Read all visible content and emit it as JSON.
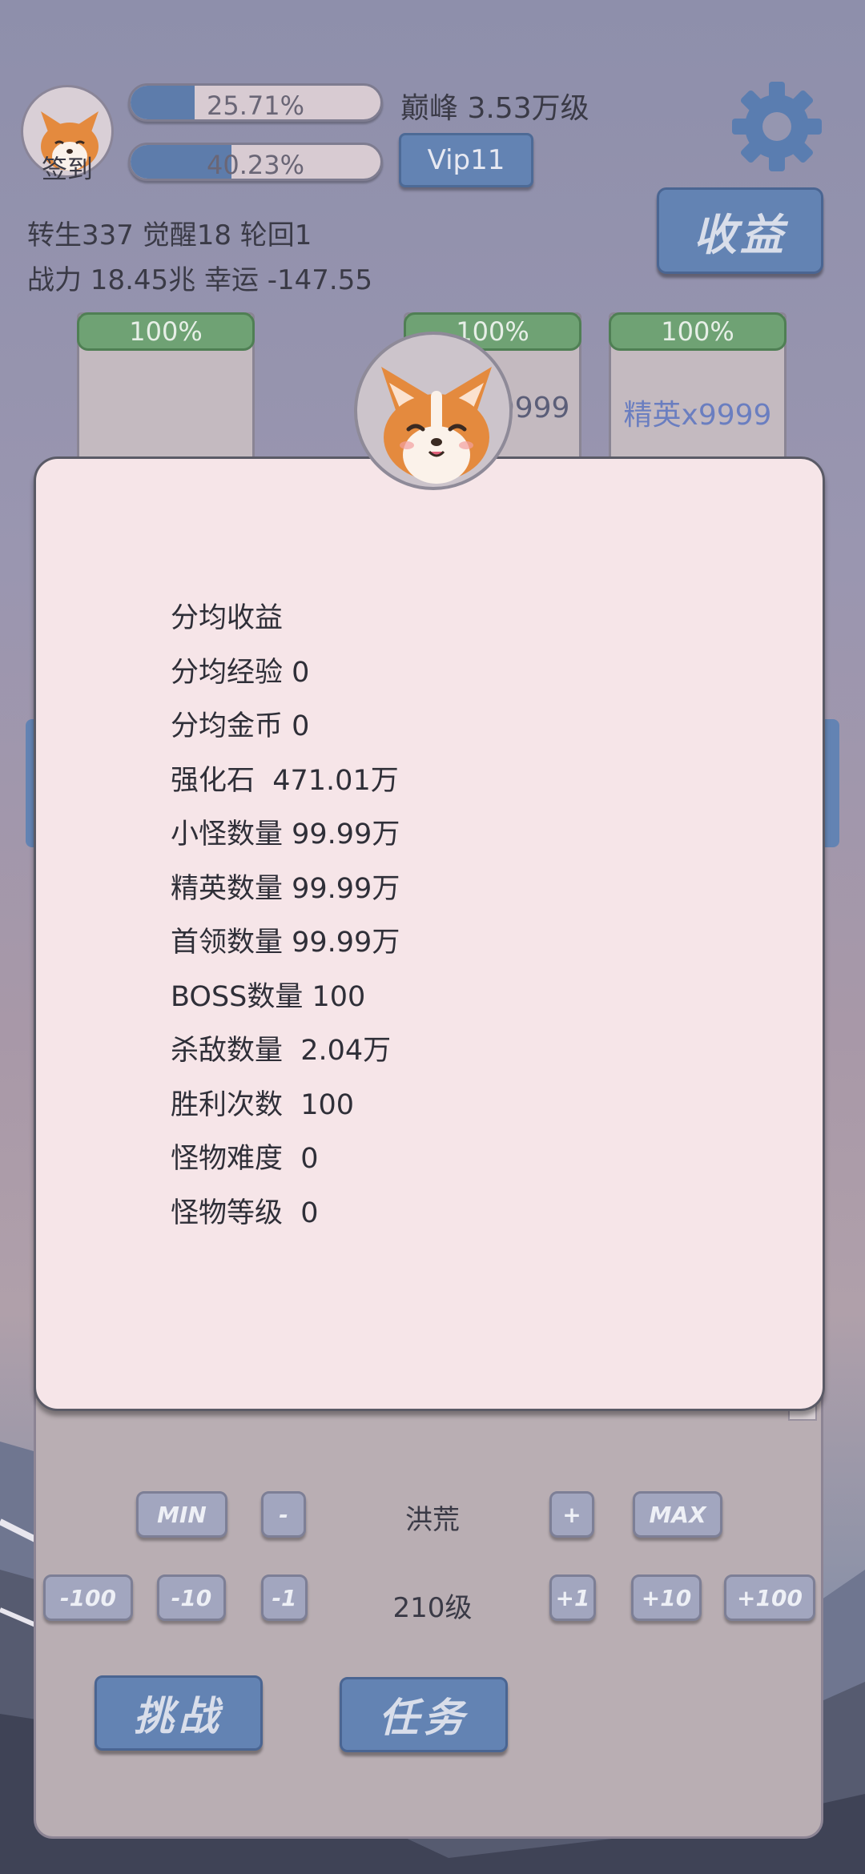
{
  "header": {
    "avatar_label": "签到",
    "bar1_text": "25.71%",
    "bar1_progress": 0.2571,
    "bar2_text": "40.23%",
    "bar2_progress": 0.4023,
    "peak_text": "巅峰 3.53万级",
    "vip_label": "Vip11",
    "income_label": "收益"
  },
  "stats": {
    "line1": "转生337 觉醒18 轮回1",
    "line2": "战力 18.45兆  幸运 -147.55"
  },
  "cards": [
    {
      "pct": "100%",
      "label": ""
    },
    {
      "pct": "100%",
      "label": "x9999"
    },
    {
      "pct": "100%",
      "label": "精英x9999"
    }
  ],
  "modal": {
    "rows": [
      "分均收益",
      "分均经验 0",
      "分均金币 0",
      "强化石  471.01万",
      "小怪数量 99.99万",
      "精英数量 99.99万",
      "首领数量 99.99万",
      "BOSS数量 100",
      "杀敌数量  2.04万",
      "胜利次数  100",
      "怪物难度  0",
      "怪物等级  0"
    ]
  },
  "controls": {
    "min_label": "MIN",
    "minus_label": "-",
    "area_name": "洪荒",
    "plus_label": "+",
    "max_label": "MAX",
    "m100": "-100",
    "m10": "-10",
    "m1": "-1",
    "level_text": "210级",
    "p1": "+1",
    "p10": "+10",
    "p100": "+100",
    "challenge_label": "挑战",
    "task_label": "任务"
  },
  "colors": {
    "accent_blue": "#6383b3",
    "progress_green": "#6fa274",
    "modal_bg": "#f6e5e8"
  }
}
